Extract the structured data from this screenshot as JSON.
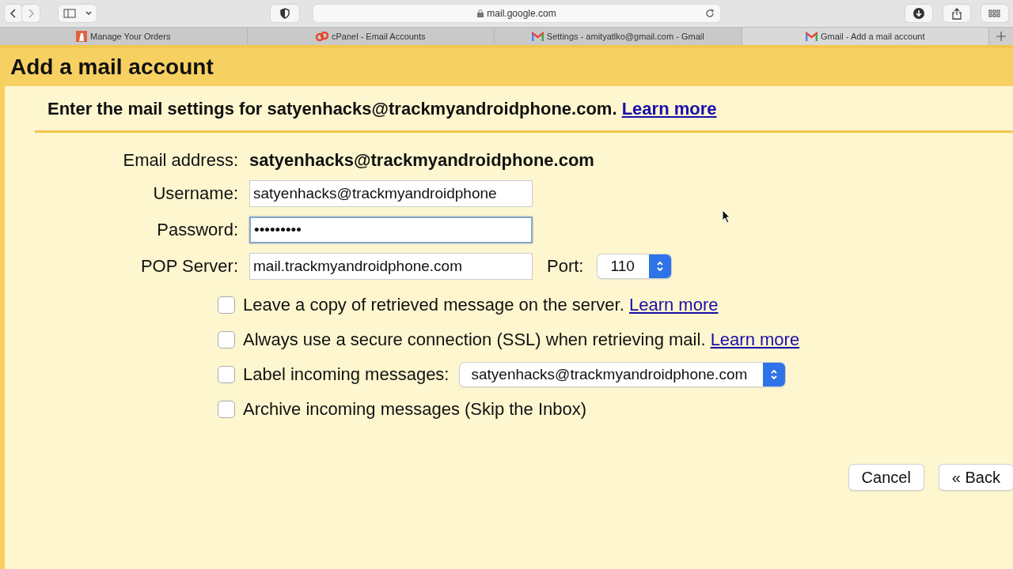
{
  "browser": {
    "url": "mail.google.com",
    "tabs": [
      {
        "label": "Manage Your Orders",
        "kind": "orders",
        "selected": false
      },
      {
        "label": "cPanel - Email Accounts",
        "kind": "cpanel",
        "selected": false
      },
      {
        "label": "Settings - amityatlko@gmail.com - Gmail",
        "kind": "gmail",
        "selected": false
      },
      {
        "label": "Gmail - Add a mail account",
        "kind": "gmail",
        "selected": true
      }
    ]
  },
  "page": {
    "title": "Add a mail account",
    "intro": "Enter the mail settings for satyenhacks@trackmyandroidphone.com.",
    "intro_link": "Learn more",
    "email_address": {
      "label": "Email address:",
      "value": "satyenhacks@trackmyandroidphone.com"
    },
    "fields": [
      {
        "label": "Username:",
        "value": "satyenhacks@trackmyandroidphone",
        "focused": false
      },
      {
        "label": "Password:",
        "value": "•••••••••",
        "focused": true
      },
      {
        "label": "POP Server:",
        "value": "mail.trackmyandroidphone.com",
        "focused": false
      }
    ],
    "port": {
      "label": "Port:",
      "value": "110"
    },
    "options": [
      {
        "label": "Leave a copy of retrieved message on the server.",
        "checked": false,
        "link": "Learn more"
      },
      {
        "label": "Always use a secure connection (SSL) when retrieving mail.",
        "checked": false,
        "link": "Learn more"
      },
      {
        "label": "Label incoming messages:",
        "checked": false,
        "select": "satyenhacks@trackmyandroidphone.com"
      },
      {
        "label": "Archive incoming messages (Skip the Inbox)",
        "checked": false
      }
    ],
    "buttons": [
      "Cancel",
      "« Back"
    ]
  }
}
